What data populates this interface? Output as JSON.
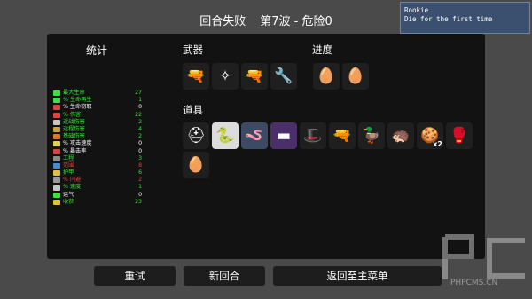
{
  "header": {
    "status": "回合失败",
    "wave": "第7波",
    "separator": "-",
    "danger": "危险0"
  },
  "toast": {
    "title": "Rookie",
    "description": "Die for the first time"
  },
  "stats": {
    "heading": "统计",
    "rows": [
      {
        "label": "最大生命",
        "value": "27",
        "color": "#3ee03e",
        "icon": "heart-icon",
        "icon_color": "#3ee03e"
      },
      {
        "label": "% 生命再生",
        "value": "1",
        "color": "#3ee03e",
        "icon": "regen-icon",
        "icon_color": "#3ee03e"
      },
      {
        "label": "% 生命窃取",
        "value": "0",
        "color": "#ffffff",
        "icon": "lifesteal-icon",
        "icon_color": "#d84545"
      },
      {
        "label": "% 伤害",
        "value": "22",
        "color": "#3ee03e",
        "icon": "damage-icon",
        "icon_color": "#d84545"
      },
      {
        "label": "近战伤害",
        "value": "2",
        "color": "#3ee03e",
        "icon": "melee-icon",
        "icon_color": "#c5c5c5"
      },
      {
        "label": "远程伤害",
        "value": "4",
        "color": "#3ee03e",
        "icon": "ranged-icon",
        "icon_color": "#c9a23a"
      },
      {
        "label": "基础伤害",
        "value": "2",
        "color": "#3ee03e",
        "icon": "elemental-icon",
        "icon_color": "#e0762a"
      },
      {
        "label": "% 攻击速度",
        "value": "0",
        "color": "#ffffff",
        "icon": "attack-speed-icon",
        "icon_color": "#e0d04a"
      },
      {
        "label": "% 暴击率",
        "value": "0",
        "color": "#ffffff",
        "icon": "crit-icon",
        "icon_color": "#d84545"
      },
      {
        "label": "工程",
        "value": "3",
        "color": "#3ee03e",
        "icon": "engineering-icon",
        "icon_color": "#8a8a8a"
      },
      {
        "label": "范围",
        "value": "8",
        "color": "#e03e3e",
        "icon": "range-icon",
        "icon_color": "#4a8ad0"
      },
      {
        "label": "护甲",
        "value": "6",
        "color": "#3ee03e",
        "icon": "armor-icon",
        "icon_color": "#e0c23a"
      },
      {
        "label": "% 闪避",
        "value": "2",
        "color": "#e03e3e",
        "icon": "dodge-icon",
        "icon_color": "#9a9a9a"
      },
      {
        "label": "% 速度",
        "value": "1",
        "color": "#3ee03e",
        "icon": "speed-icon",
        "icon_color": "#c5c5c5"
      },
      {
        "label": "运气",
        "value": "0",
        "color": "#ffffff",
        "icon": "luck-icon",
        "icon_color": "#3ee03e"
      },
      {
        "label": "收获",
        "value": "23",
        "color": "#3ee03e",
        "icon": "harvest-icon",
        "icon_color": "#e0c23a"
      }
    ]
  },
  "weapons": {
    "heading": "武器",
    "items": [
      {
        "name": "shotgun-icon",
        "glyph": "🔫"
      },
      {
        "name": "crossbow-icon",
        "glyph": "✧"
      },
      {
        "name": "shotgun-icon",
        "glyph": "🔫"
      },
      {
        "name": "wrench-icon",
        "glyph": "🔧"
      }
    ]
  },
  "progress": {
    "heading": "进度",
    "items": [
      {
        "name": "egg-icon",
        "glyph": "🥚"
      },
      {
        "name": "egg-icon",
        "glyph": "🥚"
      }
    ]
  },
  "items": {
    "heading": "道具",
    "list": [
      {
        "name": "helmet-icon",
        "glyph": "⛑",
        "highlight": ""
      },
      {
        "name": "snake-icon",
        "glyph": "🐍",
        "highlight": "white"
      },
      {
        "name": "worm-icon",
        "glyph": "🪱",
        "highlight": "blue"
      },
      {
        "name": "turret-icon",
        "glyph": "▬",
        "highlight": "purple"
      },
      {
        "name": "hat-icon",
        "glyph": "🎩",
        "highlight": ""
      },
      {
        "name": "gun-icon",
        "glyph": "🔫",
        "highlight": ""
      },
      {
        "name": "duck-icon",
        "glyph": "🦆",
        "highlight": ""
      },
      {
        "name": "hedgehog-icon",
        "glyph": "🦔",
        "highlight": ""
      },
      {
        "name": "cookie-icon",
        "glyph": "🍪",
        "highlight": "",
        "qty": "x2"
      },
      {
        "name": "glove-icon",
        "glyph": "🥊",
        "highlight": ""
      },
      {
        "name": "egg-icon",
        "glyph": "🥚",
        "highlight": ""
      }
    ]
  },
  "buttons": {
    "retry": "重试",
    "new_run": "新回合",
    "main_menu": "返回至主菜单"
  },
  "watermark": {
    "text": "PHPCMS.CN"
  }
}
